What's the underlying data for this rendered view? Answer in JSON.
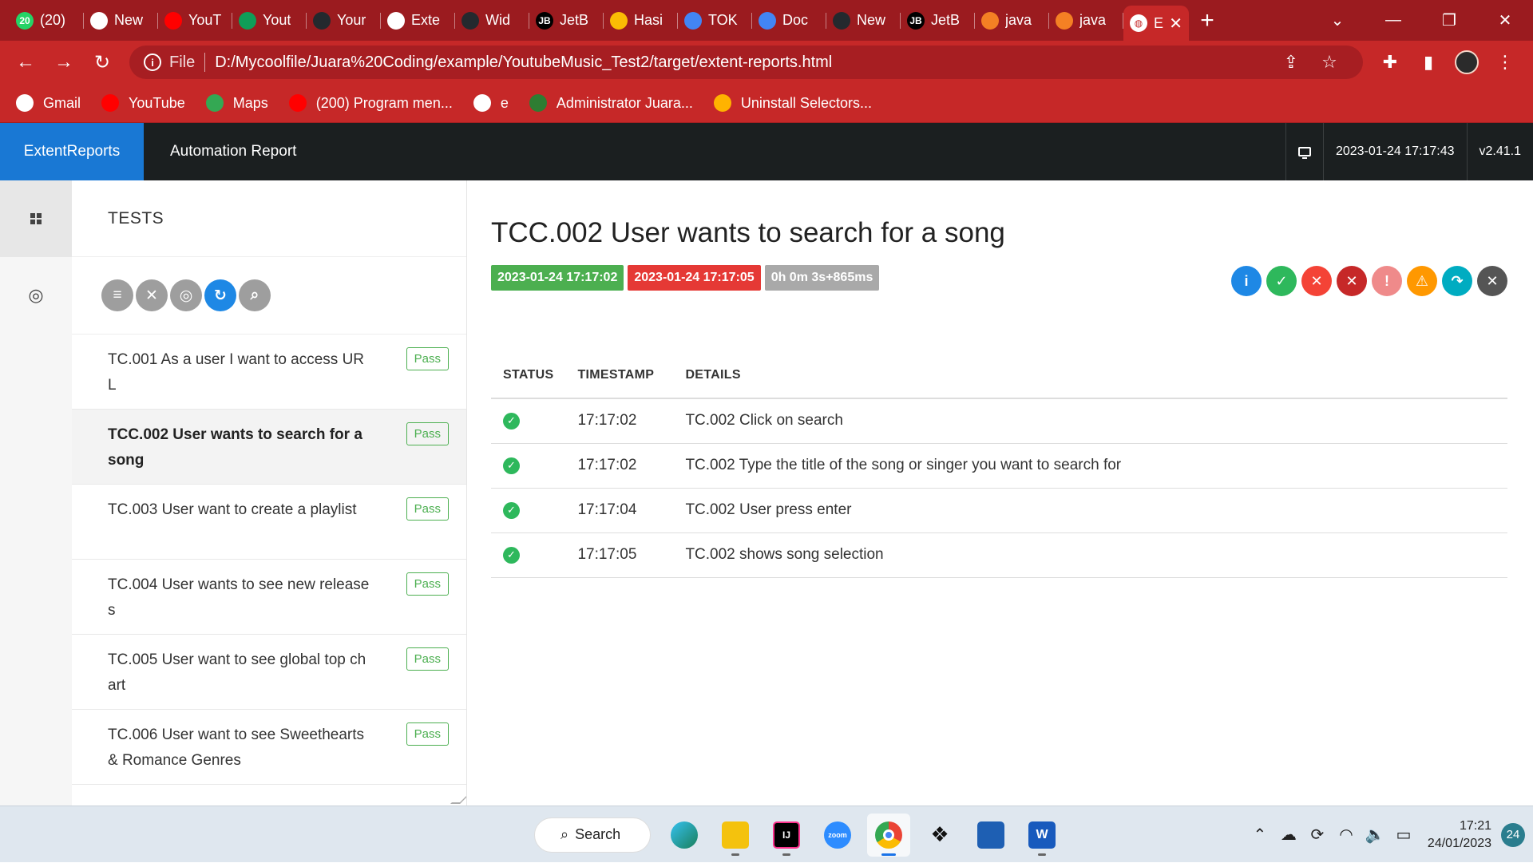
{
  "browser": {
    "tabs": [
      {
        "favicon": "whatsapp-icon",
        "title": "(20)",
        "badge": "20",
        "color": "#25d366"
      },
      {
        "favicon": "chrome-icon",
        "title": "New",
        "color": "#ffffff"
      },
      {
        "favicon": "youtube-icon",
        "title": "YouT",
        "color": "#ff0000"
      },
      {
        "favicon": "sheets-icon",
        "title": "Yout",
        "color": "#0f9d58"
      },
      {
        "favicon": "github-icon",
        "title": "Your",
        "color": "#24292e"
      },
      {
        "favicon": "globe-icon",
        "title": "Exte",
        "color": "#ffffff"
      },
      {
        "favicon": "github-icon",
        "title": "Wid",
        "color": "#24292e"
      },
      {
        "favicon": "jetbrains-icon",
        "title": "JetB",
        "badge": "JB",
        "color": "#000000"
      },
      {
        "favicon": "drive-icon",
        "title": "Hasi",
        "color": "#fbbc04"
      },
      {
        "favicon": "docs-icon",
        "title": "TOK",
        "color": "#4285f4"
      },
      {
        "favicon": "docs-icon",
        "title": "Doc",
        "color": "#4285f4"
      },
      {
        "favicon": "github-icon",
        "title": "New",
        "color": "#24292e"
      },
      {
        "favicon": "jetbrains-icon",
        "title": "JetB",
        "badge": "JB",
        "color": "#000000"
      },
      {
        "favicon": "stackoverflow-icon",
        "title": "java",
        "color": "#f48024"
      },
      {
        "favicon": "stackoverflow-icon",
        "title": "java",
        "color": "#f48024"
      }
    ],
    "active_tab": {
      "favicon": "globe-icon",
      "title": "E"
    },
    "url_scheme": "File",
    "url": "D:/Mycoolfile/Juara%20Coding/example/YoutubeMusic_Test2/target/extent-reports.html",
    "bookmarks": [
      {
        "icon": "google-icon",
        "label": "Gmail",
        "color": "#ffffff"
      },
      {
        "icon": "youtube-icon",
        "label": "YouTube",
        "color": "#ff0000"
      },
      {
        "icon": "maps-icon",
        "label": "Maps",
        "color": "#34a853"
      },
      {
        "icon": "youtube-icon",
        "label": "(200) Program men...",
        "color": "#ff0000"
      },
      {
        "icon": "globe-icon",
        "label": "e",
        "color": "#ffffff"
      },
      {
        "icon": "shield-icon",
        "label": "Administrator Juara...",
        "color": "#2e7d32"
      },
      {
        "icon": "selectors-icon",
        "label": "Uninstall Selectors...",
        "color": "#ffb300"
      }
    ]
  },
  "report": {
    "brand": "ExtentReports",
    "name": "Automation Report",
    "timestamp": "2023-01-24 17:17:43",
    "version": "v2.41.1",
    "tests_heading": "TESTS",
    "tests": [
      {
        "name": "TC.001 As a user I want to access URL",
        "status": "Pass"
      },
      {
        "name": "TCC.002 User wants to search for a song",
        "status": "Pass"
      },
      {
        "name": "TC.003 User want to create a playlist",
        "status": "Pass"
      },
      {
        "name": "TC.004 User wants to see new releases",
        "status": "Pass"
      },
      {
        "name": "TC.005 User want to see global top chart",
        "status": "Pass"
      },
      {
        "name": "TC.006 User want to see Sweethearts & Romance Genres",
        "status": "Pass"
      }
    ],
    "detail": {
      "title": "TCC.002 User wants to search for a song",
      "start": "2023-01-24 17:17:02",
      "end": "2023-01-24 17:17:05",
      "duration": "0h 0m 3s+865ms",
      "columns": {
        "status": "STATUS",
        "timestamp": "TIMESTAMP",
        "details": "DETAILS"
      },
      "logs": [
        {
          "status": "pass",
          "time": "17:17:02",
          "details": "TC.002 Click on search"
        },
        {
          "status": "pass",
          "time": "17:17:02",
          "details": "TC.002 Type the title of the song or singer you want to search for"
        },
        {
          "status": "pass",
          "time": "17:17:04",
          "details": "TC.002 User press enter"
        },
        {
          "status": "pass",
          "time": "17:17:05",
          "details": "TC.002 shows song selection"
        }
      ]
    },
    "colors": {
      "brand": "#1978d4",
      "pass": "#2eb85c",
      "start_tag": "#4caf50",
      "end_tag": "#e53935",
      "duration_tag": "#9e9e9e"
    }
  },
  "taskbar": {
    "search_label": "Search",
    "time": "17:21",
    "date": "24/01/2023",
    "notifications": "24"
  }
}
